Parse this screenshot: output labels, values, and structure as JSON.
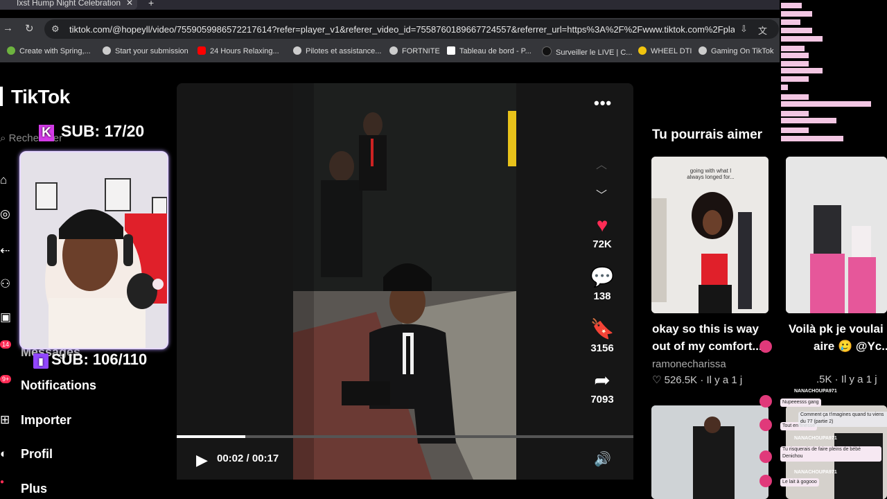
{
  "browser": {
    "tab_title": "Ixst Hump Night Celebrations",
    "tab_close": "✕",
    "new_tab": "+",
    "url": "tiktok.com/@hopeyll/video/7559059986572217614?refer=player_v1&referer_video_id=7558760189667724557&referrer_url=https%3A%2F%2Fwww.tiktok.com%2Fplayer...",
    "bookmarks": [
      {
        "label": "Create with Spring,...",
        "color": "#6db33f"
      },
      {
        "label": "Start your submission",
        "color": "#cccccc"
      },
      {
        "label": "24 Hours Relaxing...",
        "color": "#ff0000"
      },
      {
        "label": "Pilotes et assistance...",
        "color": "#cccccc"
      },
      {
        "label": "FORTNITE",
        "color": "#cccccc"
      },
      {
        "label": "Tableau de bord - P...",
        "color": "#ffffff"
      },
      {
        "label": "Surveiller le LIVE | C...",
        "color": "#111111"
      },
      {
        "label": "WHEEL DTI",
        "color": "#f1c40f"
      },
      {
        "label": "Gaming On TikTok",
        "color": "#cccccc"
      }
    ]
  },
  "sidebar": {
    "logo": "TikTok",
    "search_placeholder": "Rechercher",
    "items": [
      {
        "label": "Messages"
      },
      {
        "label": "Notifications",
        "badge": "9+"
      },
      {
        "label": "Importer"
      },
      {
        "label": "Profil"
      },
      {
        "label": "Plus"
      }
    ],
    "message_badge": "14"
  },
  "overlay": {
    "sub_kick": "SUB: 17/20",
    "sub_twitch": "SUB: 106/110"
  },
  "video": {
    "likes": "72K",
    "comments": "138",
    "saves": "3156",
    "shares": "7093",
    "time": "00:02 / 00:17",
    "progress": 0.15,
    "accent": "#fe2c55"
  },
  "recommendations": {
    "title": "Tu pourrais aimer",
    "cards": [
      {
        "thumb_caption": "going with what I always longed for...",
        "title_line1": "okay so this is way",
        "title_line2": "out of my comfort...",
        "author": "ramonecharissa",
        "meta": "♡ 526.5K · Il y a 1 j"
      },
      {
        "title_line1": "Voilà pk je voulai",
        "title_line2": "aire 🥲 @Yc...",
        "meta": ".5K · Il y a 1 j"
      }
    ]
  },
  "stream_chat": {
    "names": [
      "NANACHOUPA971",
      "NANACHOUPA971",
      "NANACHOUPA971"
    ],
    "messages": [
      "Nupeeesss gang",
      "Tout en finesse",
      "Tu risquerais de faire pleins de bébé Denichou",
      "Le lait à gogooo",
      "Comment ça t'imagines quand tu viens du 77 (partie 2)"
    ]
  }
}
